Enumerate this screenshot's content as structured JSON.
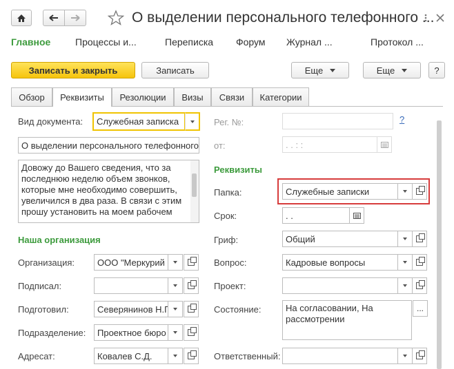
{
  "window": {
    "title": "О выделении персонального телефонного ..."
  },
  "sections": [
    "Главное",
    "Процессы и...",
    "Переписка",
    "Форум",
    "Журнал ...",
    "Протокол ..."
  ],
  "commands": {
    "save_close": "Записать и закрыть",
    "save": "Записать",
    "more1": "Еще",
    "more2": "Еще",
    "help": "?"
  },
  "tabs": [
    "Обзор",
    "Реквизиты",
    "Резолюции",
    "Визы",
    "Связи",
    "Категории"
  ],
  "form": {
    "doc_type_label": "Вид документа:",
    "doc_type_value": "Служебная записка",
    "subject_value": "О выделении персонального телефонного",
    "body_text": "Довожу до Вашего сведения, что за последнюю неделю объем звонков, которые мне необходимо совершить, увеличился в два раза. В связи с этим прошу установить на моем рабочем",
    "org_group": "Наша организация",
    "org_label": "Организация:",
    "org_value": "ООО \"Меркурий",
    "signed_label": "Подписал:",
    "signed_value": "",
    "prepared_label": "Подготовил:",
    "prepared_value": "Северянинов Н.Г",
    "dept_label": "Подразделение:",
    "dept_value": "Проектное бюро",
    "addressee_label": "Адресат:",
    "addressee_value": "Ковалев С.Д.",
    "reg_label": "Рег. №:",
    "reg_help": "?",
    "from_label": "от:",
    "from_value": ".   .       :   :",
    "req_group": "Реквизиты",
    "folder_label": "Папка:",
    "folder_value": "Служебные записки",
    "term_label": "Срок:",
    "term_value": ".   .",
    "stamp_label": "Гриф:",
    "stamp_value": "Общий",
    "question_label": "Вопрос:",
    "question_value": "Кадровые вопросы",
    "project_label": "Проект:",
    "project_value": "",
    "state_label": "Состояние:",
    "state_value": "На согласовании, На рассмотрении",
    "state_btn": "...",
    "responsible_label": "Ответственный:",
    "responsible_value": ""
  },
  "colors": {
    "accent_green": "#3d9b3d",
    "primary_yellow": "#f6c40c",
    "highlight_red": "#d73b3b"
  }
}
